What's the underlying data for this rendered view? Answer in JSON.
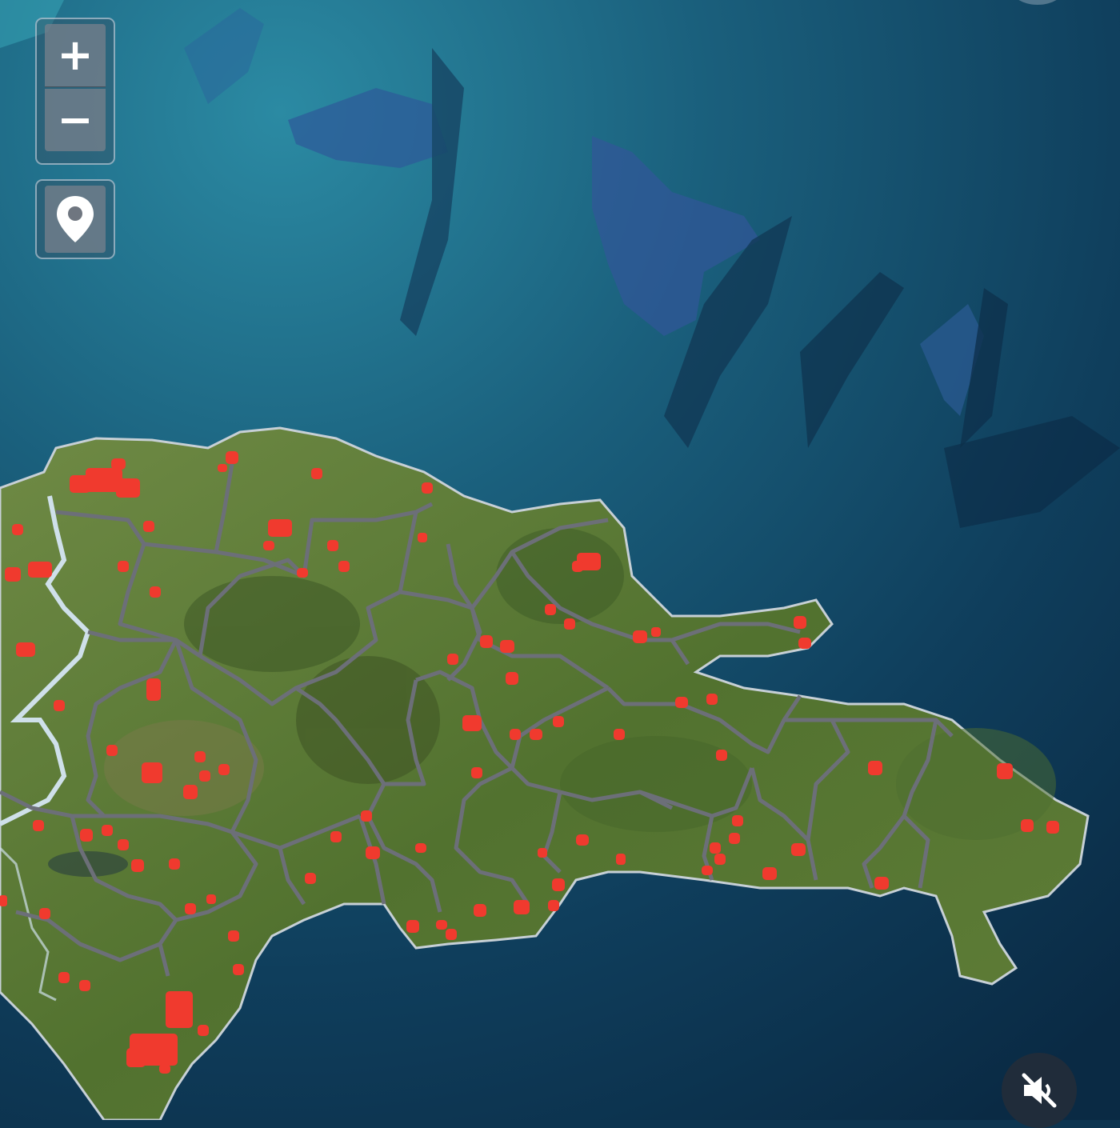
{
  "map": {
    "colors": {
      "ocean_deep": "#0b2b45",
      "ocean_shallow": "#1f6f8a",
      "land_green": "#5a7b3a",
      "land_dark": "#3d5a28",
      "boundary": "#6c6f78",
      "border": "#c8d4de",
      "hotspot": "#f03a2e"
    },
    "hotspot_count": 96
  },
  "controls": {
    "zoom_in_label": "+",
    "zoom_out_label": "−",
    "location_icon": "map-pin-icon",
    "mute_icon": "speaker-muted-icon"
  }
}
